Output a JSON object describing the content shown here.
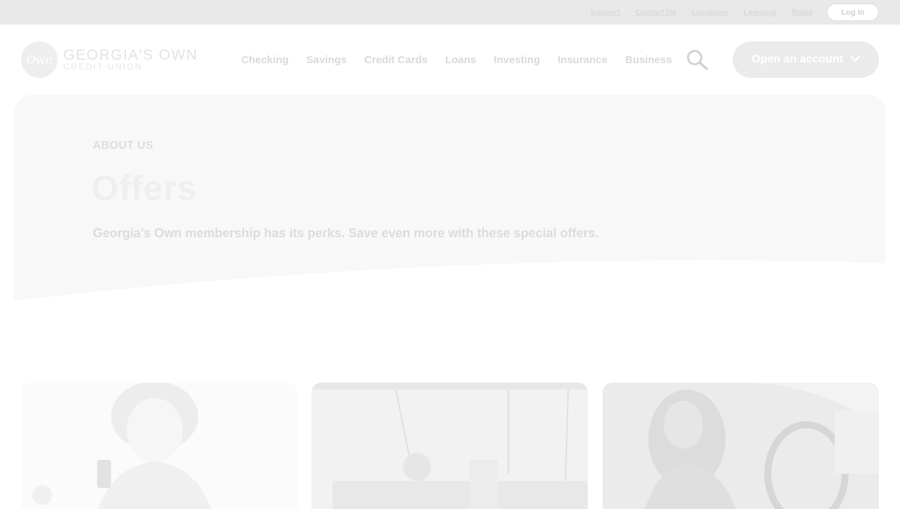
{
  "utility_bar": {
    "links": [
      "Support",
      "Contact Us",
      "Locations",
      "Learning",
      "Rates"
    ],
    "login_label": "Log In"
  },
  "logo": {
    "badge_text": "Own",
    "name": "GEORGIA'S OWN",
    "sub": "CREDIT UNION"
  },
  "nav": {
    "items": [
      "Checking",
      "Savings",
      "Credit Cards",
      "Loans",
      "Investing",
      "Insurance",
      "Business"
    ],
    "open_account_label": "Open an account"
  },
  "hero": {
    "eyebrow": "ABOUT US",
    "title": "Offers",
    "description": "Georgia’s Own membership has its perks. Save even more with these special offers."
  },
  "icons": {
    "search": "search-icon",
    "dropdown": "chevron-down-icon"
  },
  "colors": {
    "utility_bg": "#e9e9e9",
    "hero_bg": "#f8f8f8",
    "button_bg": "#ebebeb"
  }
}
